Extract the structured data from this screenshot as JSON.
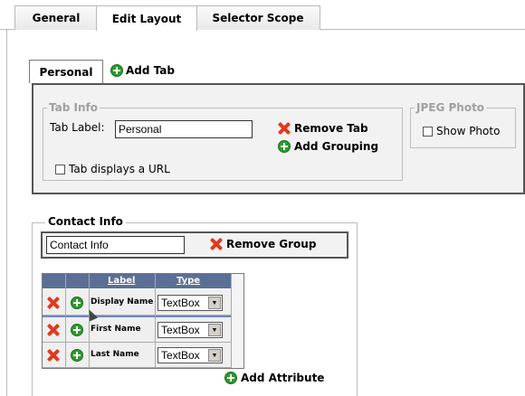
{
  "top_tabs": [
    {
      "label": "General"
    },
    {
      "label": "Edit Layout"
    },
    {
      "label": "Selector Scope"
    }
  ],
  "inner_tabs": {
    "active_label": "Personal",
    "add_label": "Add Tab"
  },
  "tab_info": {
    "legend": "Tab Info",
    "tab_label_caption": "Tab Label:",
    "tab_label_value": "Personal",
    "remove_tab": "Remove Tab",
    "add_grouping": "Add Grouping",
    "url_checkbox": "Tab displays a URL"
  },
  "jpeg_photo": {
    "legend": "JPEG Photo",
    "show_photo": "Show Photo"
  },
  "contact": {
    "legend": "Contact Info",
    "group_name": "Contact Info",
    "remove_group": "Remove Group",
    "columns": [
      "Label",
      "Type"
    ],
    "rows": [
      {
        "label": "Display Name",
        "type": "TextBox"
      },
      {
        "label": "First Name",
        "type": "TextBox"
      },
      {
        "label": "Last Name",
        "type": "TextBox"
      }
    ],
    "add_attribute": "Add Attribute"
  },
  "colors": {
    "grid_header": "#5b6f96",
    "remove_icon": "#e03a1e",
    "add_icon": "#2e9a2e"
  }
}
